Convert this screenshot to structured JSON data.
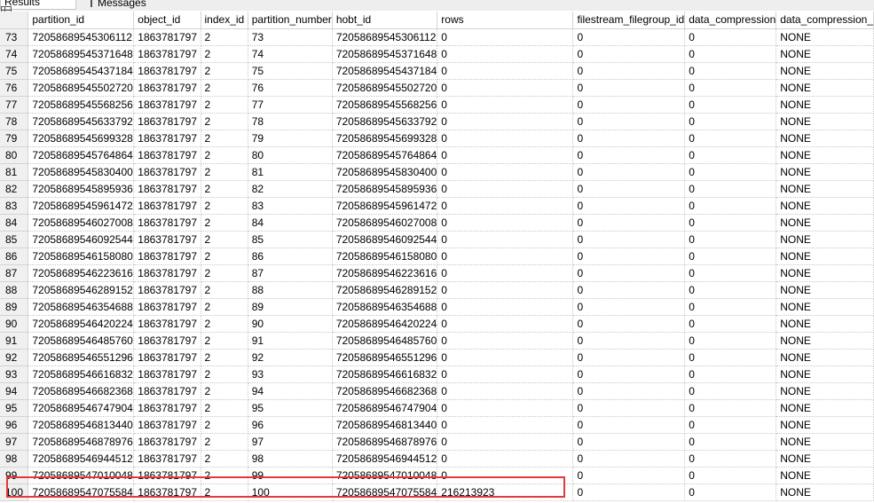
{
  "tabs": {
    "results_label": "Results",
    "messages_label": "Messages"
  },
  "columns": [
    "partition_id",
    "object_id",
    "index_id",
    "partition_number",
    "hobt_id",
    "rows",
    "filestream_filegroup_id",
    "data_compression",
    "data_compression_"
  ],
  "rows": [
    {
      "num": "73",
      "cells": [
        "72058689545306112",
        "1863781797",
        "2",
        "73",
        "72058689545306112",
        "0",
        "0",
        "0",
        "NONE"
      ]
    },
    {
      "num": "74",
      "cells": [
        "72058689545371648",
        "1863781797",
        "2",
        "74",
        "72058689545371648",
        "0",
        "0",
        "0",
        "NONE"
      ]
    },
    {
      "num": "75",
      "cells": [
        "72058689545437184",
        "1863781797",
        "2",
        "75",
        "72058689545437184",
        "0",
        "0",
        "0",
        "NONE"
      ]
    },
    {
      "num": "76",
      "cells": [
        "72058689545502720",
        "1863781797",
        "2",
        "76",
        "72058689545502720",
        "0",
        "0",
        "0",
        "NONE"
      ]
    },
    {
      "num": "77",
      "cells": [
        "72058689545568256",
        "1863781797",
        "2",
        "77",
        "72058689545568256",
        "0",
        "0",
        "0",
        "NONE"
      ]
    },
    {
      "num": "78",
      "cells": [
        "72058689545633792",
        "1863781797",
        "2",
        "78",
        "72058689545633792",
        "0",
        "0",
        "0",
        "NONE"
      ]
    },
    {
      "num": "79",
      "cells": [
        "72058689545699328",
        "1863781797",
        "2",
        "79",
        "72058689545699328",
        "0",
        "0",
        "0",
        "NONE"
      ]
    },
    {
      "num": "80",
      "cells": [
        "72058689545764864",
        "1863781797",
        "2",
        "80",
        "72058689545764864",
        "0",
        "0",
        "0",
        "NONE"
      ]
    },
    {
      "num": "81",
      "cells": [
        "72058689545830400",
        "1863781797",
        "2",
        "81",
        "72058689545830400",
        "0",
        "0",
        "0",
        "NONE"
      ]
    },
    {
      "num": "82",
      "cells": [
        "72058689545895936",
        "1863781797",
        "2",
        "82",
        "72058689545895936",
        "0",
        "0",
        "0",
        "NONE"
      ]
    },
    {
      "num": "83",
      "cells": [
        "72058689545961472",
        "1863781797",
        "2",
        "83",
        "72058689545961472",
        "0",
        "0",
        "0",
        "NONE"
      ]
    },
    {
      "num": "84",
      "cells": [
        "72058689546027008",
        "1863781797",
        "2",
        "84",
        "72058689546027008",
        "0",
        "0",
        "0",
        "NONE"
      ]
    },
    {
      "num": "85",
      "cells": [
        "72058689546092544",
        "1863781797",
        "2",
        "85",
        "72058689546092544",
        "0",
        "0",
        "0",
        "NONE"
      ]
    },
    {
      "num": "86",
      "cells": [
        "72058689546158080",
        "1863781797",
        "2",
        "86",
        "72058689546158080",
        "0",
        "0",
        "0",
        "NONE"
      ]
    },
    {
      "num": "87",
      "cells": [
        "72058689546223616",
        "1863781797",
        "2",
        "87",
        "72058689546223616",
        "0",
        "0",
        "0",
        "NONE"
      ]
    },
    {
      "num": "88",
      "cells": [
        "72058689546289152",
        "1863781797",
        "2",
        "88",
        "72058689546289152",
        "0",
        "0",
        "0",
        "NONE"
      ]
    },
    {
      "num": "89",
      "cells": [
        "72058689546354688",
        "1863781797",
        "2",
        "89",
        "72058689546354688",
        "0",
        "0",
        "0",
        "NONE"
      ]
    },
    {
      "num": "90",
      "cells": [
        "72058689546420224",
        "1863781797",
        "2",
        "90",
        "72058689546420224",
        "0",
        "0",
        "0",
        "NONE"
      ]
    },
    {
      "num": "91",
      "cells": [
        "72058689546485760",
        "1863781797",
        "2",
        "91",
        "72058689546485760",
        "0",
        "0",
        "0",
        "NONE"
      ]
    },
    {
      "num": "92",
      "cells": [
        "72058689546551296",
        "1863781797",
        "2",
        "92",
        "72058689546551296",
        "0",
        "0",
        "0",
        "NONE"
      ]
    },
    {
      "num": "93",
      "cells": [
        "72058689546616832",
        "1863781797",
        "2",
        "93",
        "72058689546616832",
        "0",
        "0",
        "0",
        "NONE"
      ]
    },
    {
      "num": "94",
      "cells": [
        "72058689546682368",
        "1863781797",
        "2",
        "94",
        "72058689546682368",
        "0",
        "0",
        "0",
        "NONE"
      ]
    },
    {
      "num": "95",
      "cells": [
        "72058689546747904",
        "1863781797",
        "2",
        "95",
        "72058689546747904",
        "0",
        "0",
        "0",
        "NONE"
      ]
    },
    {
      "num": "96",
      "cells": [
        "72058689546813440",
        "1863781797",
        "2",
        "96",
        "72058689546813440",
        "0",
        "0",
        "0",
        "NONE"
      ]
    },
    {
      "num": "97",
      "cells": [
        "72058689546878976",
        "1863781797",
        "2",
        "97",
        "72058689546878976",
        "0",
        "0",
        "0",
        "NONE"
      ]
    },
    {
      "num": "98",
      "cells": [
        "72058689546944512",
        "1863781797",
        "2",
        "98",
        "72058689546944512",
        "0",
        "0",
        "0",
        "NONE"
      ]
    },
    {
      "num": "99",
      "cells": [
        "72058689547010048",
        "1863781797",
        "2",
        "99",
        "72058689547010048",
        "0",
        "0",
        "0",
        "NONE"
      ]
    },
    {
      "num": "100",
      "cells": [
        "72058689547075584",
        "1863781797",
        "2",
        "100",
        "72058689547075584",
        "216213923",
        "0",
        "0",
        "NONE"
      ]
    }
  ],
  "highlight_color": "#e03a3a"
}
